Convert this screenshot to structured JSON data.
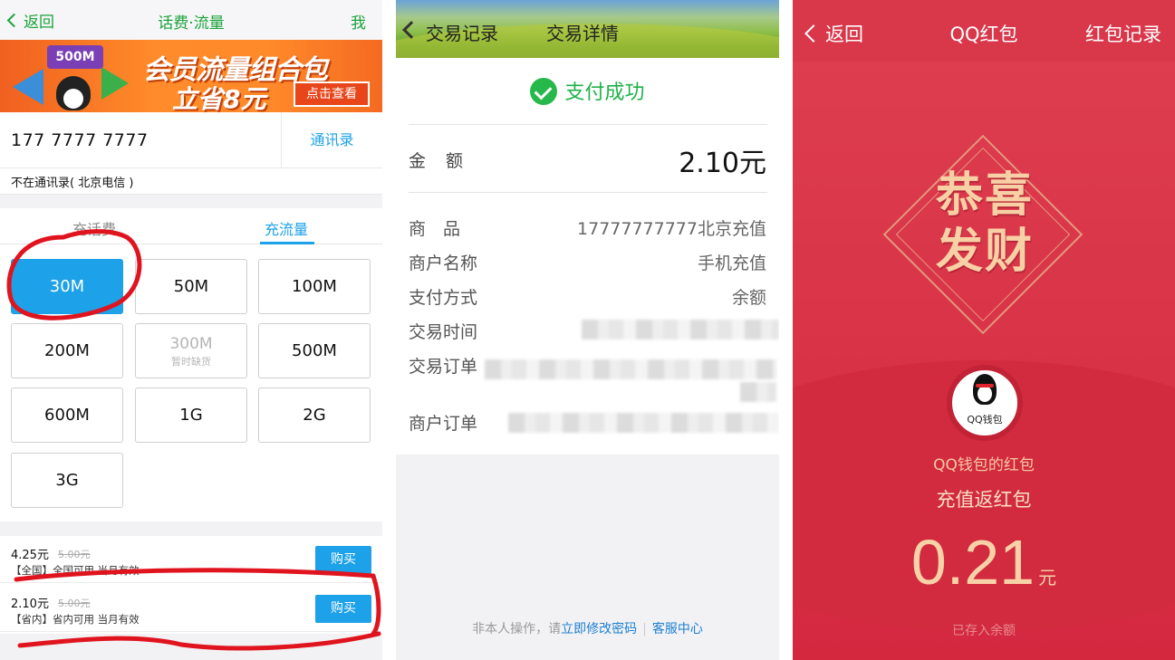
{
  "panel1": {
    "nav": {
      "back": "返回",
      "title": "话费·流量",
      "me": "我"
    },
    "banner": {
      "badge": "500M",
      "line1": "会员流量组合包",
      "line2": "立省8元",
      "cta": "点击查看"
    },
    "phone": {
      "number": "177  7777  7777",
      "contacts": "通讯录",
      "carrier": "不在通讯录( 北京电信 )"
    },
    "tabs": [
      "充话费",
      "充流量"
    ],
    "grid": [
      {
        "label": "30M",
        "sub": ""
      },
      {
        "label": "50M",
        "sub": ""
      },
      {
        "label": "100M",
        "sub": ""
      },
      {
        "label": "200M",
        "sub": ""
      },
      {
        "label": "300M",
        "sub": "暂时缺货"
      },
      {
        "label": "500M",
        "sub": ""
      },
      {
        "label": "600M",
        "sub": ""
      },
      {
        "label": "1G",
        "sub": ""
      },
      {
        "label": "2G",
        "sub": ""
      },
      {
        "label": "3G",
        "sub": ""
      }
    ],
    "offers": [
      {
        "price": "4.25元",
        "old": "5.00元",
        "desc": "【全国】全国可用 当月有效",
        "buy": "购买"
      },
      {
        "price": "2.10元",
        "old": "5.00元",
        "desc": "【省内】省内可用 当月有效",
        "buy": "购买"
      }
    ]
  },
  "panel2": {
    "nav": {
      "back": "交易记录",
      "title": "交易详情"
    },
    "status": "支付成功",
    "amount_label": "金额",
    "amount": "2.10元",
    "rows": [
      {
        "label": "商　品",
        "value": "17777777777北京充值"
      },
      {
        "label": "商户名称",
        "value": "手机充值"
      },
      {
        "label": "支付方式",
        "value": "余额"
      },
      {
        "label": "交易时间",
        "value": ""
      },
      {
        "label": "交易订单",
        "value": ""
      },
      {
        "label": "商户订单",
        "value": ""
      }
    ],
    "footer": {
      "prefix": "非本人操作，请",
      "link1": "立即修改密码",
      "sep": "|",
      "link2": "客服中心"
    }
  },
  "panel3": {
    "nav": {
      "back": "返回",
      "title": "QQ红包",
      "records": "红包记录"
    },
    "greeting": "恭喜发财",
    "wallet_label": "QQ钱包",
    "from": "QQ钱包的红包",
    "message": "充值返红包",
    "amount": "0.21",
    "unit": "元",
    "saved": "已存入余额"
  },
  "colors": {
    "green": "#1aa33a",
    "blue": "#1da1e8",
    "red": "#d9374a",
    "gold": "#f7d2a9"
  }
}
